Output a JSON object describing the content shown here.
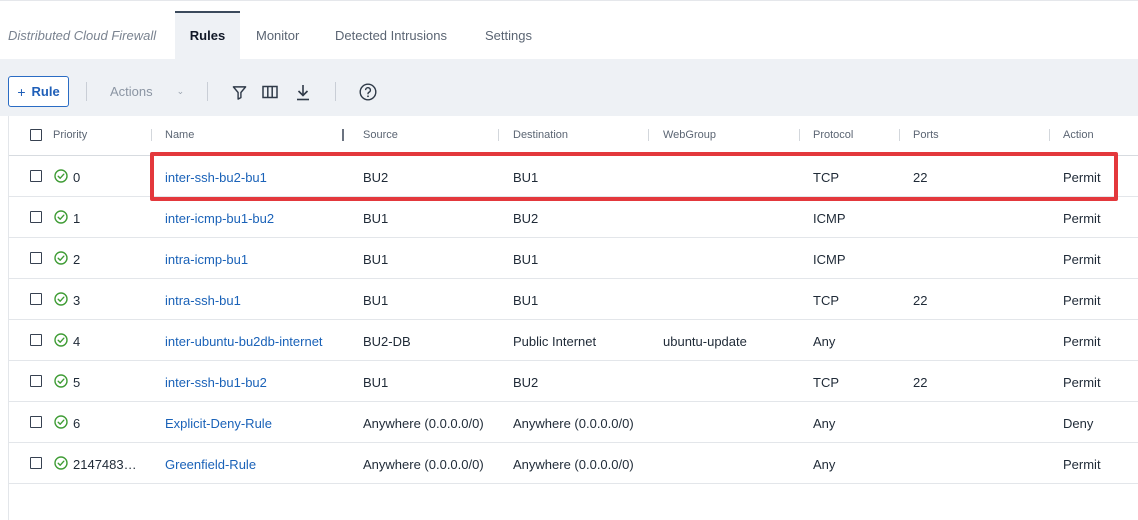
{
  "tabs": {
    "brand": "Distributed Cloud Firewall",
    "items": [
      "Rules",
      "Monitor",
      "Detected Intrusions",
      "Settings"
    ],
    "active": "Rules"
  },
  "toolbar": {
    "rule_button": "Rule",
    "actions_label": "Actions",
    "icons": [
      "filter-icon",
      "columns-icon",
      "download-icon",
      "help-icon"
    ]
  },
  "table": {
    "headers": {
      "priority": "Priority",
      "name": "Name",
      "source": "Source",
      "destination": "Destination",
      "webgroup": "WebGroup",
      "protocol": "Protocol",
      "ports": "Ports",
      "action": "Action"
    },
    "rows": [
      {
        "priority": "0",
        "name": "inter-ssh-bu2-bu1",
        "source": "BU2",
        "destination": "BU1",
        "webgroup": "",
        "protocol": "TCP",
        "ports": "22",
        "action": "Permit"
      },
      {
        "priority": "1",
        "name": "inter-icmp-bu1-bu2",
        "source": "BU1",
        "destination": "BU2",
        "webgroup": "",
        "protocol": "ICMP",
        "ports": "",
        "action": "Permit"
      },
      {
        "priority": "2",
        "name": "intra-icmp-bu1",
        "source": "BU1",
        "destination": "BU1",
        "webgroup": "",
        "protocol": "ICMP",
        "ports": "",
        "action": "Permit"
      },
      {
        "priority": "3",
        "name": "intra-ssh-bu1",
        "source": "BU1",
        "destination": "BU1",
        "webgroup": "",
        "protocol": "TCP",
        "ports": "22",
        "action": "Permit"
      },
      {
        "priority": "4",
        "name": "inter-ubuntu-bu2db-internet",
        "source": "BU2-DB",
        "destination": "Public Internet",
        "webgroup": "ubuntu-update",
        "protocol": "Any",
        "ports": "",
        "action": "Permit"
      },
      {
        "priority": "5",
        "name": "inter-ssh-bu1-bu2",
        "source": "BU1",
        "destination": "BU2",
        "webgroup": "",
        "protocol": "TCP",
        "ports": "22",
        "action": "Permit"
      },
      {
        "priority": "6",
        "name": "Explicit-Deny-Rule",
        "source": "Anywhere (0.0.0.0/0)",
        "destination": "Anywhere (0.0.0.0/0)",
        "webgroup": "",
        "protocol": "Any",
        "ports": "",
        "action": "Deny"
      },
      {
        "priority": "2147483…",
        "name": "Greenfield-Rule",
        "source": "Anywhere (0.0.0.0/0)",
        "destination": "Anywhere (0.0.0.0/0)",
        "webgroup": "",
        "protocol": "Any",
        "ports": "",
        "action": "Permit"
      }
    ],
    "status_color": "#3f9c35",
    "highlighted_row": 0
  },
  "colors": {
    "accent": "#1a62b8",
    "highlight": "#e3383c"
  }
}
